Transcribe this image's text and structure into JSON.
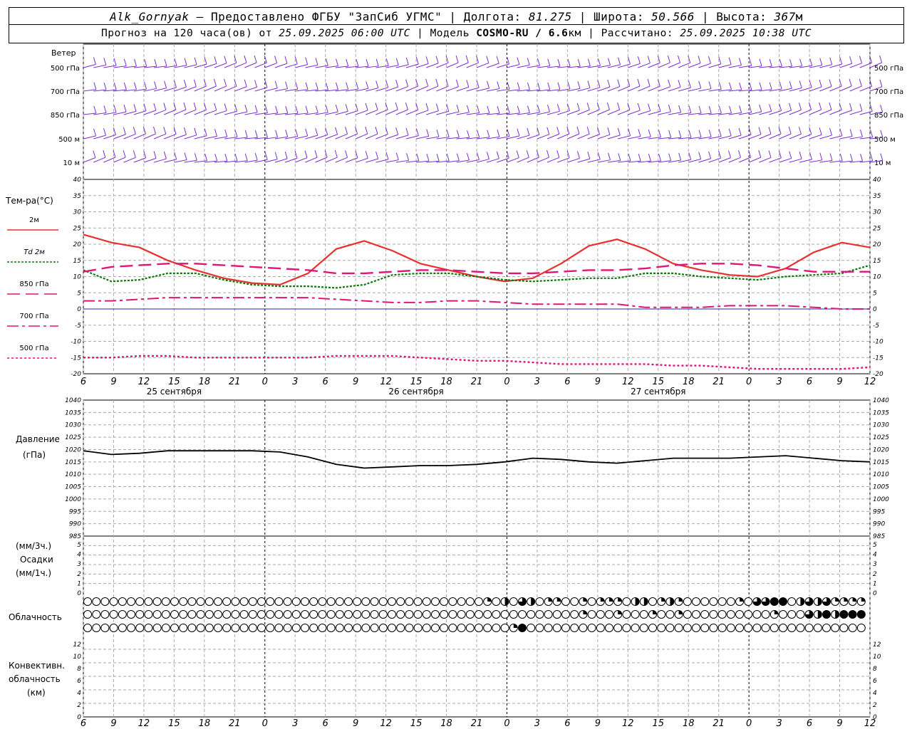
{
  "header": {
    "station": "Alk_Gornyak",
    "dash": "–",
    "provided_label": "Предоставлено ФГБУ \"ЗапСиб УГМС\"",
    "lon_label": "Долгота:",
    "lon": "81.275",
    "lat_label": "Широта:",
    "lat": "50.566",
    "alt_label": "Высота:",
    "alt": "367",
    "alt_unit": "м",
    "forecast_label": "Прогноз на 120 часа(ов) от",
    "forecast_from": "25.09.2025 06:00 UTC",
    "model_label": "Модель",
    "model": "COSMO-RU / 6.6",
    "model_unit": "км",
    "computed_label": "Рассчитано:",
    "computed": "25.09.2025 10:38 UTC"
  },
  "time_axis": {
    "hours": [
      "6",
      "9",
      "12",
      "15",
      "18",
      "21",
      "0",
      "3",
      "6",
      "9",
      "12",
      "15",
      "18",
      "21",
      "0",
      "3",
      "6",
      "9",
      "12",
      "15",
      "18",
      "21",
      "0",
      "3",
      "6",
      "9",
      "12"
    ],
    "dates": [
      "25 сентября",
      "26 сентября",
      "27 сентября"
    ]
  },
  "wind_panel": {
    "title": "Ветер",
    "levels": [
      "500 гПа",
      "700 гПа",
      "850 гПа",
      "500 м",
      "10 м"
    ]
  },
  "temp_panel": {
    "title": "Тем-ра(°С)",
    "legend": [
      {
        "label": "2м",
        "color": "#e83030"
      },
      {
        "label": "Td 2м",
        "color": "#0a7a0a"
      },
      {
        "label": "850 гПа",
        "color": "#e0157a"
      },
      {
        "label": "700 гПа",
        "color": "#e0157a"
      },
      {
        "label": "500 гПа",
        "color": "#e0157a"
      }
    ],
    "ticks": [
      "40",
      "35",
      "30",
      "25",
      "20",
      "15",
      "10",
      "5",
      "0",
      "-5",
      "-10",
      "-15",
      "-20"
    ]
  },
  "pressure_panel": {
    "title": "Давление",
    "unit": "(гПа)",
    "ticks": [
      "1040",
      "1035",
      "1030",
      "1025",
      "1020",
      "1015",
      "1010",
      "1005",
      "1000",
      "995",
      "990",
      "985"
    ]
  },
  "precip_panel": {
    "unit_3h": "(мм/3ч.)",
    "title": "Осадки",
    "unit_1h": "(мм/1ч.)",
    "ticks": [
      "5",
      "4",
      "3",
      "2",
      "1",
      "0"
    ]
  },
  "cloud_panel": {
    "title": "Облачность"
  },
  "conv_panel": {
    "title": "Конвективн.",
    "title2": "облачность",
    "unit": "(км)",
    "ticks": [
      "12",
      "10",
      "8",
      "6",
      "4",
      "2",
      "0"
    ]
  },
  "chart_data": {
    "type": "line",
    "x_unit": "hours from 25.09.2025 06:00 UTC",
    "x": [
      0,
      3,
      6,
      9,
      12,
      15,
      18,
      21,
      24,
      27,
      30,
      33,
      36,
      39,
      42,
      45,
      48,
      51,
      54,
      57,
      60,
      63,
      66,
      69,
      72,
      75,
      78
    ],
    "temperature": {
      "ylim": [
        -20,
        40
      ],
      "series": [
        {
          "name": "2м",
          "values": [
            23,
            20.5,
            19,
            15,
            12,
            9.5,
            8,
            7.5,
            11,
            18.5,
            21,
            18,
            14,
            12,
            10,
            8.5,
            9.5,
            14,
            19.5,
            21.5,
            18.5,
            14,
            12,
            10.5,
            10,
            12.5,
            17.5,
            20.5,
            19
          ]
        },
        {
          "name": "Td 2м",
          "values": [
            12,
            8.5,
            9,
            11,
            11,
            9,
            7.5,
            7,
            7,
            6.5,
            7.5,
            10.5,
            11,
            11,
            10,
            9,
            8.5,
            9,
            9.5,
            9.5,
            11,
            11,
            10,
            9.5,
            9,
            10,
            10.5,
            11,
            13.5
          ]
        },
        {
          "name": "850 гПа",
          "values": [
            11.5,
            13,
            13.5,
            14,
            14,
            13.5,
            13,
            12.5,
            12,
            11,
            11,
            11.5,
            12,
            12,
            11.5,
            11,
            11,
            11.5,
            12,
            12,
            12.5,
            13.5,
            14,
            14,
            13.5,
            12.5,
            11.5,
            11.5,
            11.5
          ]
        },
        {
          "name": "700 гПа",
          "values": [
            2.5,
            2.5,
            3,
            3.5,
            3.5,
            3.5,
            3.5,
            3.5,
            3.5,
            3,
            2.5,
            2,
            2,
            2.5,
            2.5,
            2,
            1.5,
            1.5,
            1.5,
            1.5,
            0.5,
            0.5,
            0.5,
            1,
            1,
            1,
            0.5,
            0,
            0
          ]
        },
        {
          "name": "500 гПа",
          "values": [
            -15,
            -15,
            -14.5,
            -14.5,
            -15,
            -15,
            -15,
            -15,
            -15,
            -14.5,
            -14.5,
            -14.5,
            -15,
            -15.5,
            -16,
            -16,
            -16.5,
            -17,
            -17,
            -17,
            -17,
            -17.5,
            -17.5,
            -18,
            -18.5,
            -18.5,
            -18.5,
            -18.5,
            -18
          ]
        }
      ]
    },
    "pressure": {
      "ylim": [
        985,
        1040
      ],
      "series": [
        {
          "name": "Давление",
          "values": [
            1019.5,
            1018,
            1018.5,
            1019.5,
            1019.5,
            1019.5,
            1019.5,
            1019,
            1017,
            1014,
            1012.5,
            1013,
            1013.5,
            1013.5,
            1014,
            1015,
            1016.5,
            1016,
            1015,
            1014.5,
            1015.5,
            1016.5,
            1016.5,
            1016.5,
            1017,
            1017.5,
            1016.5,
            1015.5,
            1015
          ]
        }
      ]
    },
    "precipitation": {
      "ylim": [
        0,
        5
      ],
      "values": []
    },
    "convective_cloud": {
      "ylim": [
        0,
        12
      ],
      "values": []
    },
    "cloud_cover": {
      "rows": [
        {
          "level": "upper",
          "mid": [
            [
              46,
              1
            ],
            [
              48,
              2
            ],
            [
              50,
              3
            ],
            [
              51,
              2
            ],
            [
              53,
              1
            ],
            [
              54,
              1
            ],
            [
              57,
              1
            ],
            [
              59,
              1
            ],
            [
              60,
              1
            ],
            [
              61,
              1
            ],
            [
              63,
              2
            ],
            [
              64,
              2
            ],
            [
              66,
              1
            ],
            [
              67,
              2
            ],
            [
              68,
              1
            ],
            [
              75,
              1
            ],
            [
              77,
              3
            ],
            [
              78,
              3
            ],
            [
              79,
              4
            ],
            [
              80,
              4
            ],
            [
              82,
              2
            ],
            [
              83,
              3
            ],
            [
              84,
              2
            ],
            [
              85,
              3
            ],
            [
              86,
              1
            ],
            [
              87,
              1
            ],
            [
              88,
              1
            ],
            [
              89,
              1
            ]
          ]
        },
        {
          "level": "middle",
          "mid": [
            [
              57,
              1
            ],
            [
              61,
              1
            ],
            [
              65,
              1
            ],
            [
              68,
              1
            ],
            [
              79,
              1
            ],
            [
              83,
              3
            ],
            [
              84,
              2
            ],
            [
              85,
              4
            ],
            [
              86,
              2
            ],
            [
              87,
              4
            ],
            [
              88,
              4
            ],
            [
              89,
              4
            ]
          ]
        },
        {
          "level": "lower",
          "mid": [
            [
              49,
              1
            ],
            [
              50,
              4
            ]
          ]
        }
      ],
      "note": "values: 0 clear, 1 quarter, 2 half, 3 three-quarters, 4 overcast"
    },
    "wind": {
      "levels": [
        "500 гПа",
        "700 гПа",
        "850 гПа",
        "500 м",
        "10 м"
      ],
      "grid": "barbs every hour"
    }
  },
  "colors": {
    "t2m": "#e83030",
    "td": "#0a7a0a",
    "isobaric": "#e0157a",
    "wind": "#7a2fcf",
    "zero": "#2020c0"
  }
}
